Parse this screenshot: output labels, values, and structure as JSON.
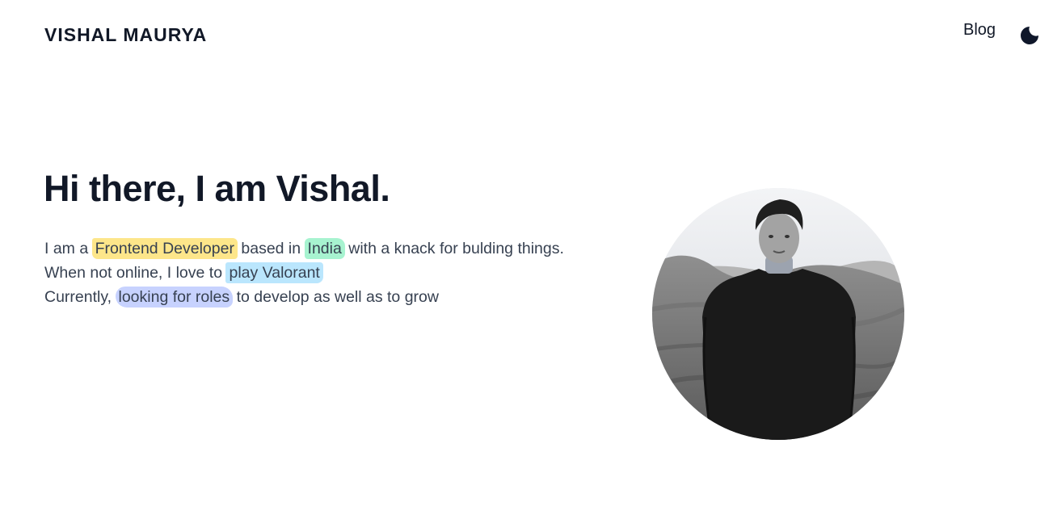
{
  "header": {
    "brand": "VISHAL MAURYA",
    "nav": {
      "blog_label": "Blog"
    },
    "theme_toggle_icon": "moon-icon"
  },
  "hero": {
    "title": "Hi there, I am Vishal.",
    "line1": {
      "pre": "I am a ",
      "highlight1": "Frontend Developer",
      "mid": " based in ",
      "highlight2": "India",
      "post": " with a knack for bulding things."
    },
    "line2": {
      "pre": "When not online, I love to ",
      "highlight": "play Valorant"
    },
    "line3": {
      "pre": "Currently, ",
      "highlight": "looking for roles",
      "post": " to develop as well as to grow"
    },
    "highlight_colors": {
      "yellow": "#fde68a",
      "green": "#a7f3d0",
      "blue": "#bae6fd",
      "indigo": "#c7d2fe"
    }
  },
  "avatar": {
    "style": "grayscale circular portrait"
  }
}
